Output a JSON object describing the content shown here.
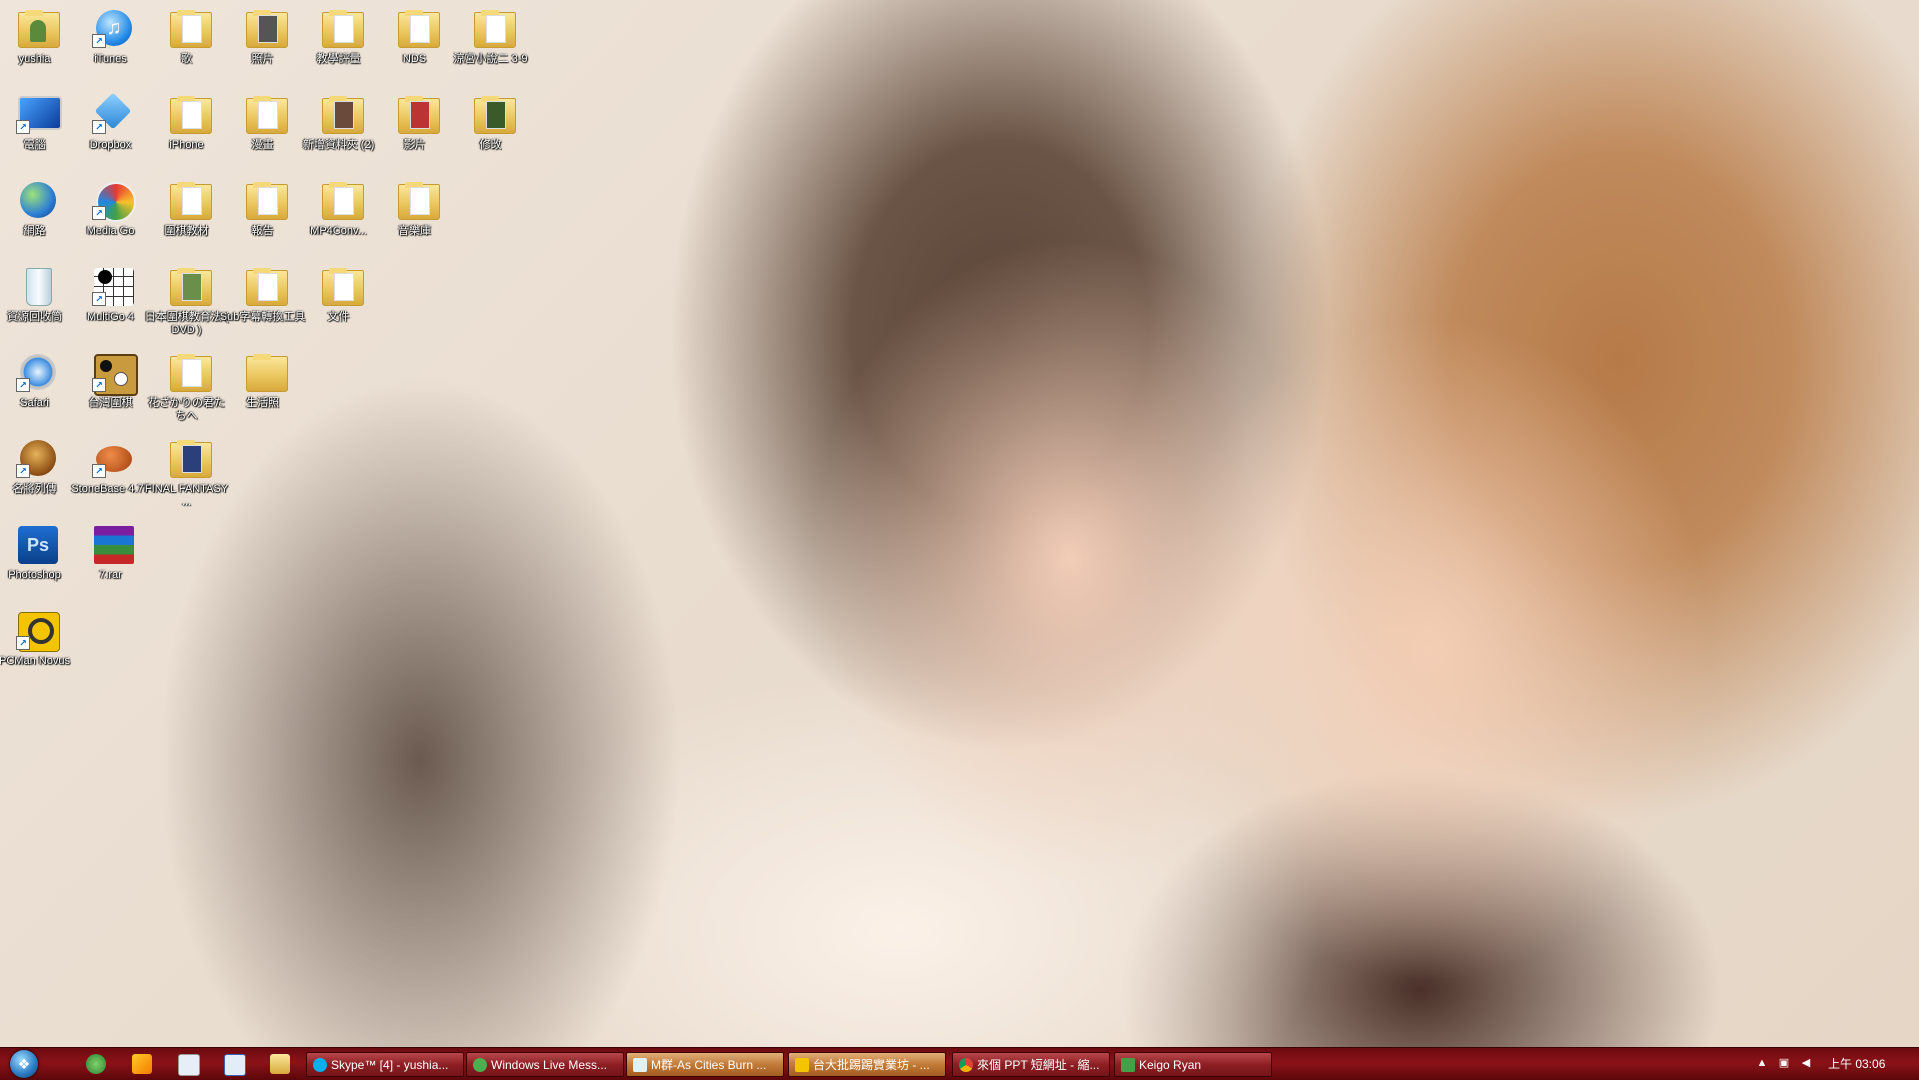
{
  "desktop": {
    "icons": [
      {
        "label": "yushia",
        "icon": "user-folder-icon"
      },
      {
        "label": "iTunes",
        "icon": "itunes-icon"
      },
      {
        "label": "歌",
        "icon": "folder-icon"
      },
      {
        "label": "照片",
        "icon": "folder-icon"
      },
      {
        "label": "教學評量",
        "icon": "folder-icon"
      },
      {
        "label": "NDS",
        "icon": "folder-icon"
      },
      {
        "label": "涼宮小說二 3-9",
        "icon": "folder-icon"
      },
      {
        "label": "電腦",
        "icon": "computer-icon"
      },
      {
        "label": "Dropbox",
        "icon": "dropbox-icon"
      },
      {
        "label": "iPhone",
        "icon": "folder-icon"
      },
      {
        "label": "漫畫",
        "icon": "folder-icon"
      },
      {
        "label": "新增資料夾 (2)",
        "icon": "folder-icon"
      },
      {
        "label": "影片",
        "icon": "folder-icon"
      },
      {
        "label": "修改",
        "icon": "folder-icon"
      },
      {
        "label": "網路",
        "icon": "network-icon"
      },
      {
        "label": "Media Go",
        "icon": "media-go-icon"
      },
      {
        "label": "圍棋教材",
        "icon": "folder-icon"
      },
      {
        "label": "報告",
        "icon": "folder-icon"
      },
      {
        "label": "MP4Conv...",
        "icon": "folder-icon"
      },
      {
        "label": "音樂庫",
        "icon": "folder-icon"
      },
      {
        "label": "資源回收筒",
        "icon": "recycle-bin-icon"
      },
      {
        "label": "MultiGo 4",
        "icon": "multigo-icon"
      },
      {
        "label": "日本圍棋教育法 ( DVD )",
        "icon": "folder-icon"
      },
      {
        "label": "Sub字幕轉換工具",
        "icon": "folder-icon"
      },
      {
        "label": "文件",
        "icon": "folder-icon"
      },
      {
        "label": "Safari",
        "icon": "safari-icon"
      },
      {
        "label": "台灣圍棋",
        "icon": "go-game-icon"
      },
      {
        "label": "花ざかりの君たちへ",
        "icon": "folder-icon"
      },
      {
        "label": "生活照",
        "icon": "folder-icon"
      },
      {
        "label": "名將列傳",
        "icon": "warrior-game-icon"
      },
      {
        "label": "StoneBase 4.77",
        "icon": "stonebase-icon"
      },
      {
        "label": "FINAL FANTASY ...",
        "icon": "folder-icon"
      },
      {
        "label": "Photoshop",
        "icon": "photoshop-icon"
      },
      {
        "label": "7.rar",
        "icon": "winrar-icon"
      },
      {
        "label": "PCMan Novus",
        "icon": "pcman-icon"
      }
    ]
  },
  "taskbar": {
    "tasks": [
      {
        "label": "Skype™ [4] - yushia...",
        "icon": "skype-icon",
        "active": false
      },
      {
        "label": "Windows Live Mess...",
        "icon": "messenger-icon",
        "active": false
      },
      {
        "label": "M群-As Cities Burn ...",
        "icon": "music-icon",
        "active": false
      },
      {
        "label": "台大批踢踢實業坊 - ...",
        "icon": "pcman-icon",
        "active": true
      },
      {
        "label": "來個 PPT 短網址 - 縮...",
        "icon": "chrome-icon",
        "active": false
      },
      {
        "label": "Keigo Ryan",
        "icon": "contact-icon",
        "active": false
      }
    ],
    "clock": "上午 03:06"
  },
  "colors": {
    "taskbar": "#8b1217",
    "active_task": "#c27a37"
  }
}
